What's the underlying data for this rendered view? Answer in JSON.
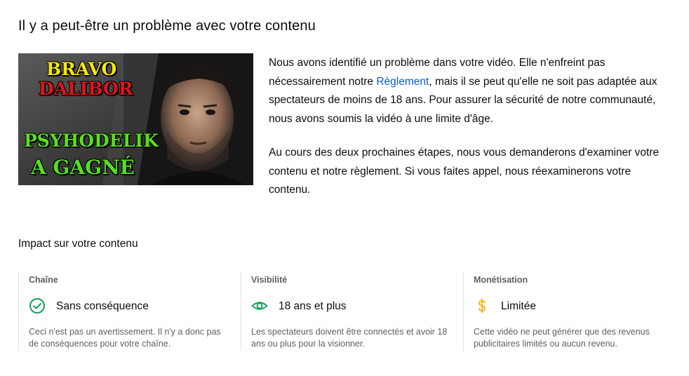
{
  "page": {
    "title": "Il y a peut-être un problème avec votre contenu"
  },
  "thumbnail": {
    "line1": "BRAVO",
    "line2": "DALIBOR",
    "line3": "PSYHODELIK",
    "line4": "A GAGNÉ"
  },
  "description": {
    "p1_before_link": "Nous avons identifié un problème dans votre vidéo. Elle n'enfreint pas nécessairement notre ",
    "p1_link": "Règlement",
    "p1_after_link": ", mais il se peut qu'elle ne soit pas adaptée aux spectateurs de moins de 18 ans. Pour assurer la sécurité de notre communauté, nous avons soumis la vidéo à une limite d'âge.",
    "p2": "Au cours des deux prochaines étapes, nous vous demanderons d'examiner votre contenu et notre règlement. Si vous faites appel, nous réexaminerons votre contenu."
  },
  "impact": {
    "heading": "Impact sur votre contenu",
    "cards": [
      {
        "title": "Chaîne",
        "icon": "check-circle-icon",
        "value": "Sans conséquence",
        "description": "Ceci n'est pas un avertissement. Il n'y a donc pas de conséquences pour votre chaîne."
      },
      {
        "title": "Visibilité",
        "icon": "eye-icon",
        "value": "18 ans et plus",
        "description": "Les spectateurs doivent être connectés et avoir 18 ans ou plus pour la visionner."
      },
      {
        "title": "Monétisation",
        "icon": "dollar-icon",
        "value": "Limitée",
        "description": "Cette vidéo ne peut générer que des revenus publicitaires limités ou aucun revenu."
      }
    ]
  },
  "colors": {
    "link": "#065fd4",
    "success": "#0f9d58",
    "warning": "#f9ab00",
    "muted": "#606060"
  }
}
